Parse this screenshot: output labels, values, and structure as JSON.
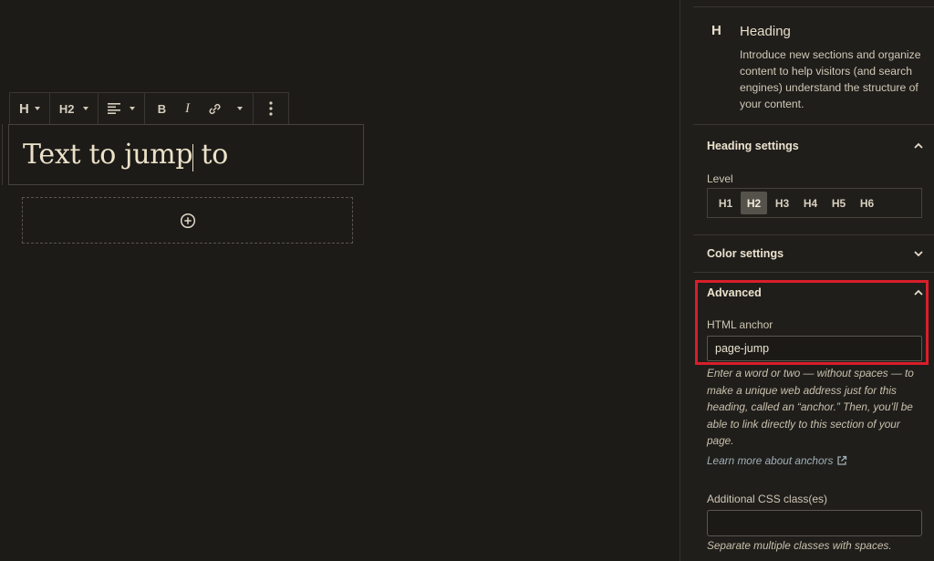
{
  "toolbar": {
    "block_type_label": "H",
    "level_label": "H2",
    "bold_label": "B",
    "italic_label": "I"
  },
  "editor": {
    "heading_text": "Text to jump to"
  },
  "sidebar": {
    "block_card": {
      "icon_label": "H",
      "title": "Heading",
      "description": "Introduce new sections and organize content to help visitors (and search engines) understand the structure of your content."
    },
    "heading_settings": {
      "title": "Heading settings",
      "level_label": "Level",
      "levels": [
        "H1",
        "H2",
        "H3",
        "H4",
        "H5",
        "H6"
      ],
      "selected_level": "H2"
    },
    "color_settings": {
      "title": "Color settings"
    },
    "advanced": {
      "title": "Advanced",
      "anchor_label": "HTML anchor",
      "anchor_value": "page-jump",
      "anchor_help": "Enter a word or two — without spaces — to make a unique web address just for this heading, called an “anchor.” Then, you’ll be able to link directly to this section of your page.",
      "learn_more": "Learn more about anchors",
      "css_label": "Additional CSS class(es)",
      "css_value": "",
      "css_help": "Separate multiple classes with spaces."
    }
  },
  "colors": {
    "background": "#1c1b18",
    "sidebar_background": "#201e1b",
    "highlight": "#d91e2a",
    "link": "#9fb0b8"
  }
}
